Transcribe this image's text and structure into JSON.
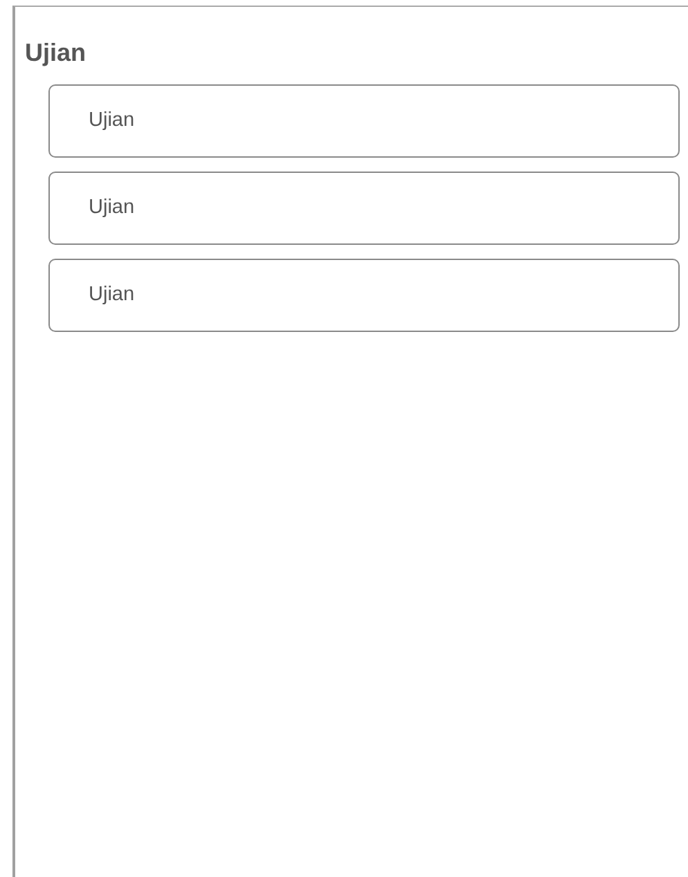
{
  "title": "Ujian",
  "items": [
    {
      "label": "Ujian"
    },
    {
      "label": "Ujian"
    },
    {
      "label": "Ujian"
    }
  ]
}
